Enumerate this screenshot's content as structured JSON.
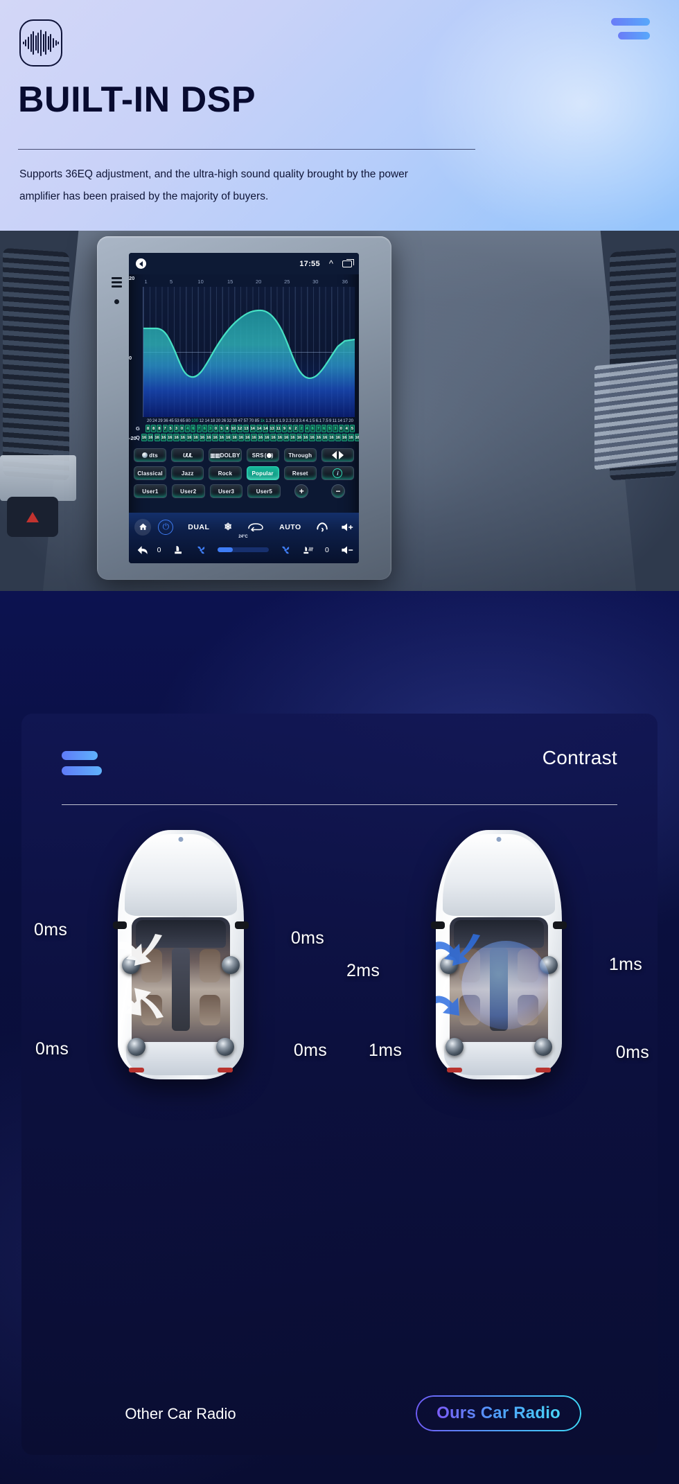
{
  "hero": {
    "logo_icon": "audio-waveform-icon",
    "menu_icon": "menu-bars-icon",
    "title": "BUILT-IN DSP",
    "subtitle": "Supports 36EQ adjustment, and the ultra-high sound quality brought by the power amplifier has been praised by the majority of buyers."
  },
  "headunit": {
    "side_menu_icon": "hamburger-icon",
    "status_bar": {
      "back_icon": "back-arrow-icon",
      "time": "17:55",
      "chevron_icon": "chevron-up-icon",
      "recents_icon": "recent-apps-icon"
    },
    "eq": {
      "y_top": "20",
      "y_mid": "0",
      "y_bottom": "-20",
      "x_ticks": [
        "1",
        "5",
        "10",
        "15",
        "20",
        "25",
        "30",
        "36"
      ],
      "g_label": "G",
      "q_label": "Q",
      "frequencies": [
        "20",
        "24",
        "29",
        "36",
        "45",
        "53",
        "65",
        "80",
        "100",
        "12",
        "14",
        "18",
        "20",
        "26",
        "32",
        "39",
        "47",
        "57",
        "70",
        "85",
        "1k",
        "1.3",
        "1.6",
        "1.9",
        "2.3",
        "2.8",
        "3.4",
        "4.1",
        "5",
        "6.1",
        "7.5",
        "9",
        "11",
        "14",
        "17",
        "20"
      ],
      "freq_highlight_index": [
        8,
        20
      ],
      "gains": [
        "8",
        "8",
        "8",
        "7",
        "5",
        "3",
        "0",
        "4",
        "6",
        "7",
        "6",
        "3",
        "0",
        "5",
        "8",
        "10",
        "12",
        "13",
        "14",
        "14",
        "14",
        "13",
        "11",
        "9",
        "6",
        "2",
        "2",
        "4",
        "6",
        "7",
        "6",
        "5",
        "3",
        "0",
        "4",
        "5"
      ],
      "gain_highlight_index": [
        7,
        8,
        9,
        10,
        11,
        26,
        27,
        28,
        29,
        30,
        31,
        32
      ],
      "q_values": [
        "16",
        "16",
        "16",
        "16",
        "16",
        "16",
        "16",
        "16",
        "16",
        "16",
        "16",
        "16",
        "16",
        "16",
        "16",
        "16",
        "16",
        "16",
        "16",
        "16",
        "16",
        "16",
        "16",
        "16",
        "16",
        "16",
        "16",
        "16",
        "16",
        "16",
        "16",
        "16",
        "16",
        "16",
        "16",
        "16"
      ]
    },
    "presets": {
      "row1": [
        {
          "label": "dts",
          "icon": "dts-logo-icon",
          "active": false
        },
        {
          "label": "UUL",
          "icon": "wwl-logo-icon",
          "active": false
        },
        {
          "label": "DOLBY",
          "icon": "dolby-logo-icon",
          "active": false
        },
        {
          "label": "SRS",
          "icon": "srs-logo-icon",
          "active": false
        },
        {
          "label": "Through",
          "icon": "",
          "active": false
        },
        {
          "label": "",
          "icon": "stereo-balance-icon",
          "active": false
        }
      ],
      "row2": [
        {
          "label": "Classical",
          "icon": "",
          "active": false
        },
        {
          "label": "Jazz",
          "icon": "",
          "active": false
        },
        {
          "label": "Rock",
          "icon": "",
          "active": false
        },
        {
          "label": "Popular",
          "icon": "",
          "active": true
        },
        {
          "label": "Reset",
          "icon": "",
          "active": false
        },
        {
          "label": "i",
          "icon": "info-icon",
          "active": false
        }
      ],
      "row3": [
        {
          "label": "User1",
          "icon": "",
          "active": false
        },
        {
          "label": "User2",
          "icon": "",
          "active": false
        },
        {
          "label": "User3",
          "icon": "",
          "active": false
        },
        {
          "label": "User5",
          "icon": "",
          "active": false
        },
        {
          "label": "+",
          "icon": "plus-icon",
          "active": false
        },
        {
          "label": "−",
          "icon": "minus-icon",
          "active": false
        }
      ]
    },
    "climate": {
      "home_icon": "home-icon",
      "power_icon": "power-icon",
      "dual_label": "DUAL",
      "ac_icon": "snowflake-icon",
      "recirc_icon": "air-recirculation-icon",
      "auto_label": "AUTO",
      "defrost_icon": "defrost-icon",
      "vol_up_icon": "volume-up-icon",
      "temperature": "24°C",
      "back_icon": "back-arrow-icon",
      "left_temp_value": "0",
      "seat_icon": "seat-icon",
      "fan_left_icon": "fan-icon",
      "fan_right_icon": "fan-icon",
      "heated_seat_icon": "heated-seat-icon",
      "right_temp_value": "0",
      "vol_down_icon": "volume-down-icon"
    }
  },
  "contrast": {
    "bars_icon": "menu-bars-icon",
    "title": "Contrast",
    "left_car": {
      "caption": "Other Car Radio",
      "labels": {
        "front_left": "0ms",
        "front_right": "0ms",
        "rear_left": "0ms",
        "rear_right": "0ms"
      }
    },
    "right_car": {
      "caption": "Ours Car Radio",
      "labels": {
        "front_left": "2ms",
        "front_right": "1ms",
        "rear_left": "1ms",
        "rear_right": "0ms"
      }
    }
  },
  "colors": {
    "accent_blue": "#5f7bf8",
    "accent_cyan": "#49d7f8",
    "eq_line": "#46e0c4",
    "preset_active": "#16b79a",
    "hero_text": "#080b30",
    "card_bg": "#111652"
  }
}
